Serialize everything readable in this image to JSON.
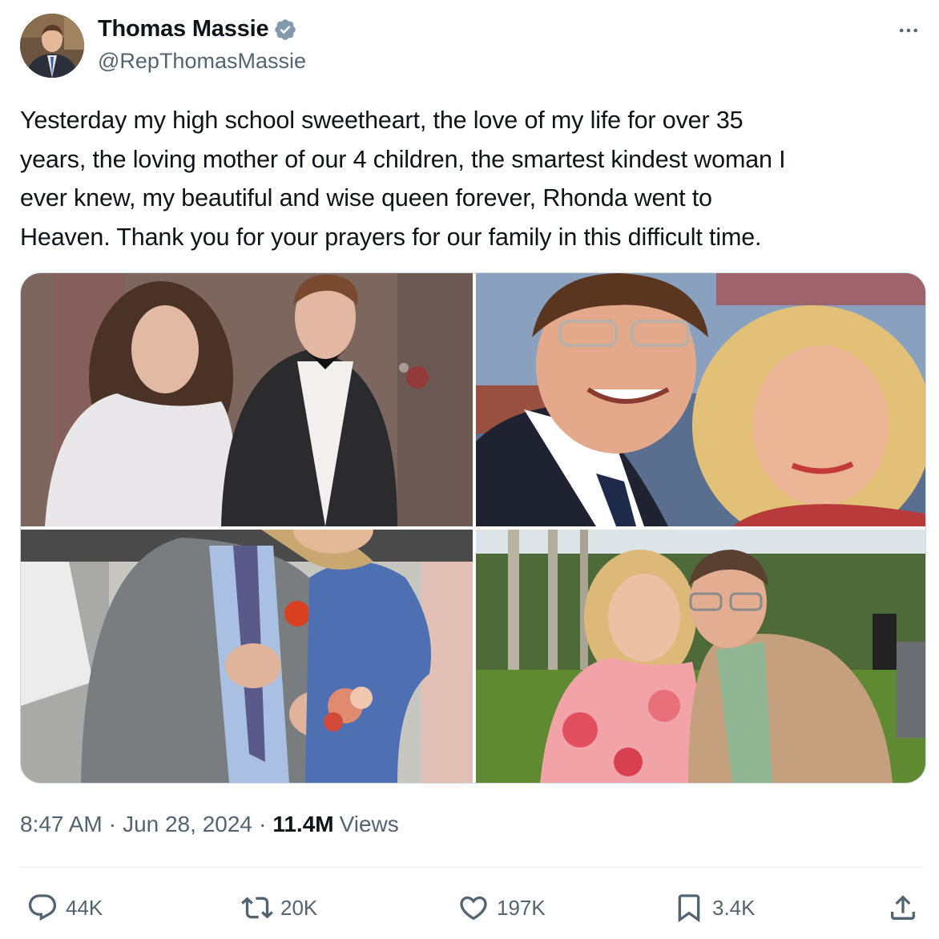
{
  "author": {
    "display_name": "Thomas Massie",
    "handle": "@RepThomasMassie",
    "verified": true,
    "verified_color": "#829aab"
  },
  "tweet": {
    "text": "Yesterday my high school sweetheart, the love of my life for over 35\nyears, the loving mother of our 4 children, the smartest kindest woman I\never knew, my beautiful and wise queen forever, Rhonda went to\nHeaven. Thank you for your prayers for our family in this difficult time."
  },
  "media": {
    "photos": [
      {
        "name": "prom-photo-vintage"
      },
      {
        "name": "stadium-selfie"
      },
      {
        "name": "wedding-guests-photo"
      },
      {
        "name": "garden-event-photo"
      }
    ]
  },
  "meta": {
    "time": "8:47 AM",
    "separator": "·",
    "date": "Jun 28, 2024",
    "views_count": "11.4M",
    "views_label": "Views"
  },
  "actions": {
    "replies": "44K",
    "reposts": "20K",
    "likes": "197K",
    "bookmarks": "3.4K"
  },
  "icons": {
    "more": "more-horizontal-icon",
    "reply": "reply-bubble-icon",
    "repost": "repost-arrows-icon",
    "like": "heart-icon",
    "bookmark": "bookmark-icon",
    "share": "share-upload-icon"
  },
  "colors": {
    "text": "#0f1419",
    "secondary": "#536471",
    "border": "#cfd9de"
  }
}
